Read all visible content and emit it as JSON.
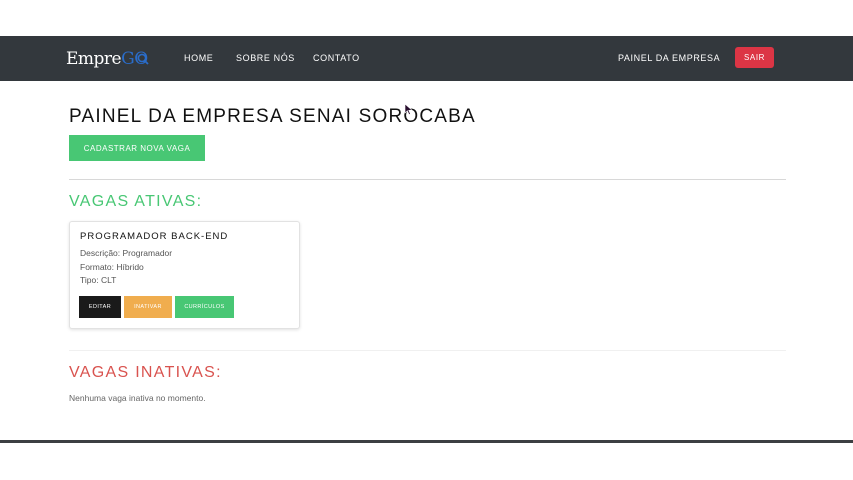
{
  "navbar": {
    "brand_main": "Empre",
    "brand_accent": "GO",
    "links": [
      "HOME",
      "SOBRE NÓS",
      "CONTATO"
    ],
    "panel_link": "PAINEL DA EMPRESA",
    "logout_label": "SAIR"
  },
  "page": {
    "title": "PAINEL DA EMPRESA SENAI SOROCABA",
    "new_job_label": "CADASTRAR NOVA VAGA"
  },
  "active_jobs": {
    "heading": "VAGAS ATIVAS:",
    "items": [
      {
        "title": "PROGRAMADOR BACK-END",
        "description": "Descrição: Programador",
        "format": "Formato: Híbrido",
        "type": "Tipo: CLT",
        "edit_label": "EDITAR",
        "deactivate_label": "INATIVAR",
        "resumes_label": "CURRÍCULOS"
      }
    ]
  },
  "inactive_jobs": {
    "heading": "VAGAS INATIVAS:",
    "empty_message": "Nenhuma vaga inativa no momento."
  },
  "colors": {
    "navbar_bg": "#33383d",
    "success": "#48c774",
    "danger": "#dc3545",
    "warning": "#f0ad4e",
    "dark": "#1a1a1a",
    "brand_accent": "#2a6cc9"
  },
  "icons": {
    "brand": "magnifier-icon",
    "cursor": "mouse-pointer-icon"
  }
}
